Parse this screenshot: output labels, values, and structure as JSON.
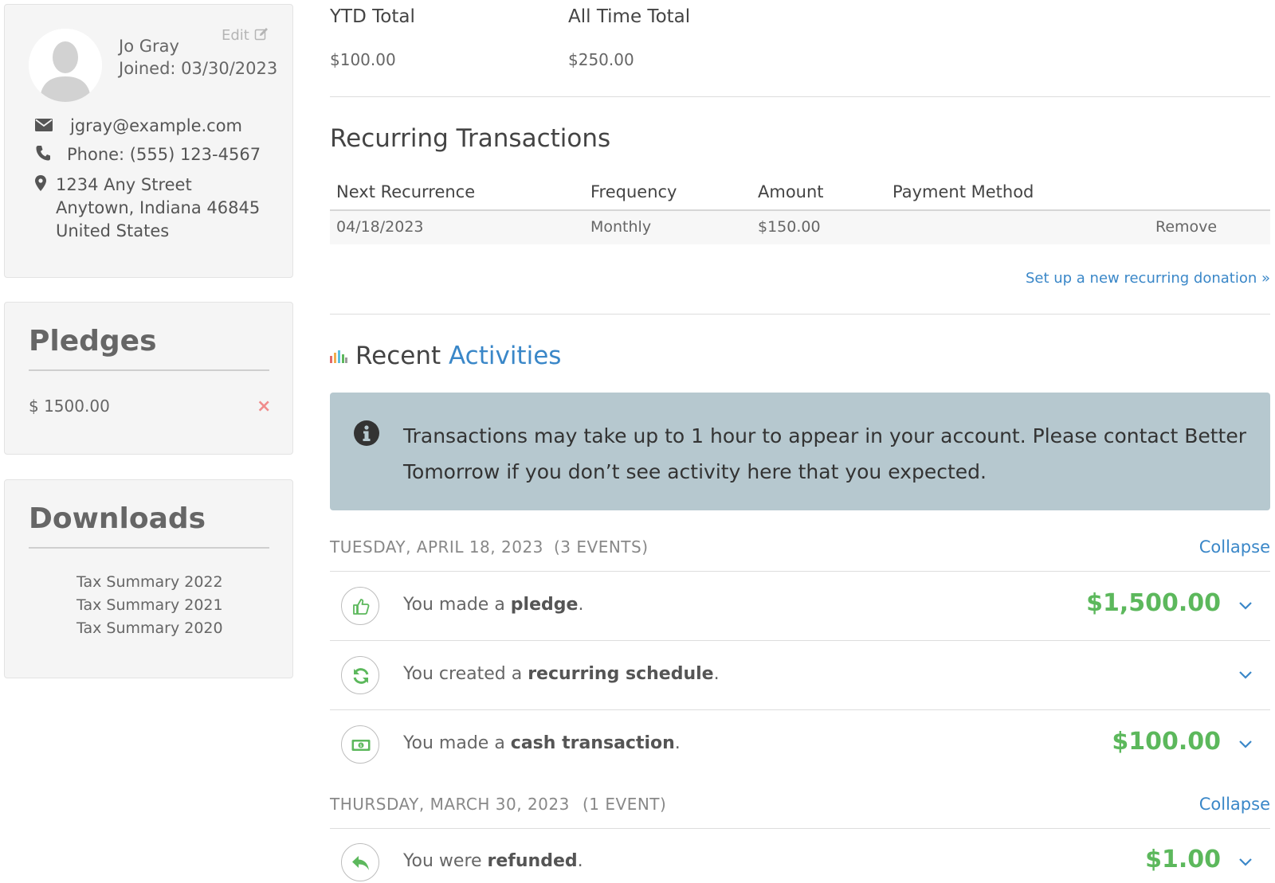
{
  "profile": {
    "name": "Jo Gray",
    "joined": "Joined: 03/30/2023",
    "edit_label": "Edit",
    "email": "jgray@example.com",
    "phone": "Phone: (555) 123-4567",
    "address": {
      "line1": "1234 Any Street",
      "line2": "Anytown, Indiana 46845",
      "line3": "United States"
    }
  },
  "pledges": {
    "title": "Pledges",
    "items": [
      {
        "amount": "$ 1500.00",
        "remove_label": "×"
      }
    ]
  },
  "downloads": {
    "title": "Downloads",
    "items": [
      {
        "label": "Tax Summary 2022"
      },
      {
        "label": "Tax Summary 2021"
      },
      {
        "label": "Tax Summary 2020"
      }
    ]
  },
  "totals": {
    "ytd_label": "YTD Total",
    "ytd_value": "$100.00",
    "all_time_label": "All Time Total",
    "all_time_value": "$250.00"
  },
  "recurring": {
    "title": "Recurring Transactions",
    "columns": [
      "Next Recurrence",
      "Frequency",
      "Amount",
      "Payment Method"
    ],
    "rows": [
      {
        "next": "04/18/2023",
        "frequency": "Monthly",
        "amount": "$150.00",
        "method": "",
        "remove_label": "Remove"
      }
    ],
    "new_link": "Set up a new recurring donation »"
  },
  "recent": {
    "title_plain": "Recent",
    "title_link": "Activities",
    "notice": "Transactions may take up to 1 hour to appear in your account. Please contact Better Tomorrow if you don’t see activity here that you expected.",
    "days": [
      {
        "date": "TUESDAY, APRIL 18, 2023",
        "count": "(3 EVENTS)",
        "collapse_label": "Collapse",
        "events": [
          {
            "icon": "thumbs-up-icon",
            "prefix": "You made a ",
            "bold": "pledge",
            "suffix": ".",
            "amount": "$1,500.00"
          },
          {
            "icon": "refresh-icon",
            "prefix": "You created a ",
            "bold": "recurring schedule",
            "suffix": ".",
            "amount": ""
          },
          {
            "icon": "cash-icon",
            "prefix": "You made a ",
            "bold": "cash transaction",
            "suffix": ".",
            "amount": "$100.00"
          }
        ]
      },
      {
        "date": "THURSDAY, MARCH 30, 2023",
        "count": "(1 EVENT)",
        "collapse_label": "Collapse",
        "events": [
          {
            "icon": "reply-icon",
            "prefix": "You were ",
            "bold": "refunded",
            "suffix": ".",
            "amount": "$1.00"
          }
        ]
      }
    ]
  },
  "colors": {
    "link": "#3a87c8",
    "amount_green": "#5cb85c",
    "notice_bg": "#b6c8cf",
    "card_bg": "#f5f5f5",
    "remove_red": "#f08c8c"
  }
}
